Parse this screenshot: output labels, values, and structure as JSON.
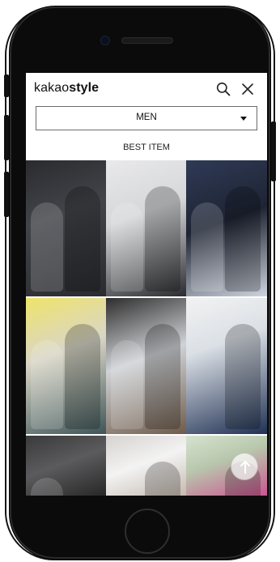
{
  "app": {
    "logo_light": "kakao",
    "logo_bold": "style"
  },
  "filter": {
    "selected": "MEN"
  },
  "section": {
    "title": "BEST ITEM"
  },
  "icons": {
    "search": "search-icon",
    "close": "close-icon",
    "dropdown": "chevron-down-icon",
    "scroll_top": "arrow-up-icon"
  },
  "colors": {
    "select_border": "#6b6b6b",
    "text": "#111111"
  }
}
